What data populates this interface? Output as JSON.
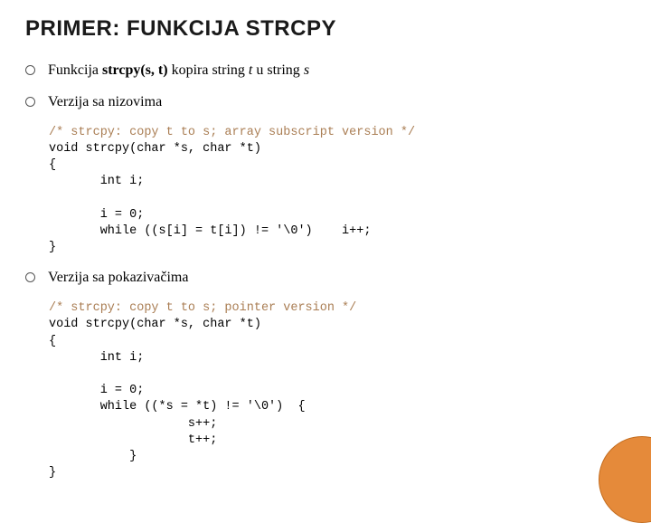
{
  "title": "PRIMER: FUNKCIJA STRCPY",
  "bullet1": {
    "prefix": "Funkcija ",
    "bold": "strcpy(s, t)",
    "mid": " kopira string ",
    "ital1": "t",
    "mid2": " u string ",
    "ital2": "s"
  },
  "bullet2": "Verzija sa nizovima",
  "code1": {
    "comment": "/* strcpy: copy t to s; array subscript version */",
    "body": "void strcpy(char *s, char *t)\n{\n       int i;\n\n       i = 0;\n       while ((s[i] = t[i]) != '\\0')    i++;\n}"
  },
  "bullet3": "Verzija sa pokazivačima",
  "code2": {
    "comment": "/* strcpy: copy t to s; pointer version */",
    "body": "void strcpy(char *s, char *t)\n{\n       int i;\n\n       i = 0;\n       while ((*s = *t) != '\\0')  {\n                   s++;\n                   t++;\n           }\n}"
  }
}
